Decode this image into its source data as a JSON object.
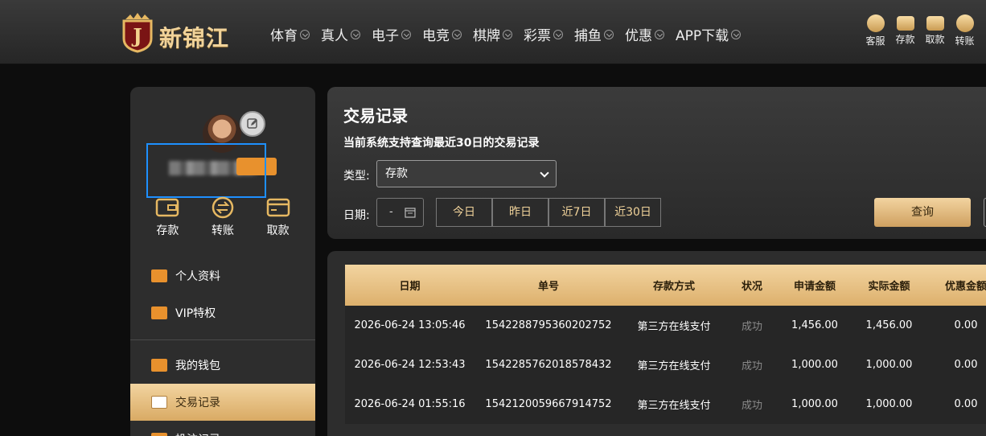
{
  "brand": {
    "name": "新锦江",
    "badge_letter": "J"
  },
  "nav": {
    "items": [
      {
        "label": "体育"
      },
      {
        "label": "真人"
      },
      {
        "label": "电子"
      },
      {
        "label": "电竞"
      },
      {
        "label": "棋牌"
      },
      {
        "label": "彩票"
      },
      {
        "label": "捕鱼"
      },
      {
        "label": "优惠"
      },
      {
        "label": "APP下载"
      }
    ]
  },
  "quick_actions": [
    {
      "label": "客服",
      "icon": "chat-icon"
    },
    {
      "label": "存款",
      "icon": "wallet-icon"
    },
    {
      "label": "取款",
      "icon": "purse-icon"
    },
    {
      "label": "转账",
      "icon": "transfer-icon"
    }
  ],
  "sidebar": {
    "wallet": [
      {
        "label": "存款",
        "icon": "deposit-icon"
      },
      {
        "label": "转账",
        "icon": "transfer-icon"
      },
      {
        "label": "取款",
        "icon": "withdraw-icon"
      }
    ],
    "menu_top": [
      {
        "label": "个人资料",
        "icon": "profile-card-icon"
      },
      {
        "label": "VIP特权",
        "icon": "vip-card-icon"
      }
    ],
    "menu_bottom": [
      {
        "label": "我的钱包",
        "icon": "piggy-bank-icon"
      },
      {
        "label": "交易记录",
        "icon": "document-icon",
        "active": true
      },
      {
        "label": "投注记录",
        "icon": "bet-record-icon"
      }
    ]
  },
  "filters": {
    "title": "交易记录",
    "notice": "当前系统支持查询最近30日的交易记录",
    "type_label": "类型:",
    "type_value": "存款",
    "date_label": "日期:",
    "date_value": "-",
    "quick_dates": [
      "今日",
      "昨日",
      "近7日",
      "近30日"
    ],
    "query_label": "查询"
  },
  "table": {
    "columns": [
      "日期",
      "单号",
      "存款方式",
      "状况",
      "申请金额",
      "实际金额",
      "优惠金额"
    ],
    "rows": [
      [
        "2026-06-24 13:05:46",
        "1542288795360202752",
        "第三方在线支付",
        "成功",
        "1,456.00",
        "1,456.00",
        "0.00"
      ],
      [
        "2026-06-24 12:53:43",
        "1542285762018578432",
        "第三方在线支付",
        "成功",
        "1,000.00",
        "1,000.00",
        "0.00"
      ],
      [
        "2026-06-24 01:55:16",
        "1542120059667914752",
        "第三方在线支付",
        "成功",
        "1,000.00",
        "1,000.00",
        "0.00"
      ]
    ]
  },
  "colors": {
    "accent_gold": "#e8c68a",
    "orange": "#e8912d",
    "selection_outline": "#1e90ff"
  }
}
